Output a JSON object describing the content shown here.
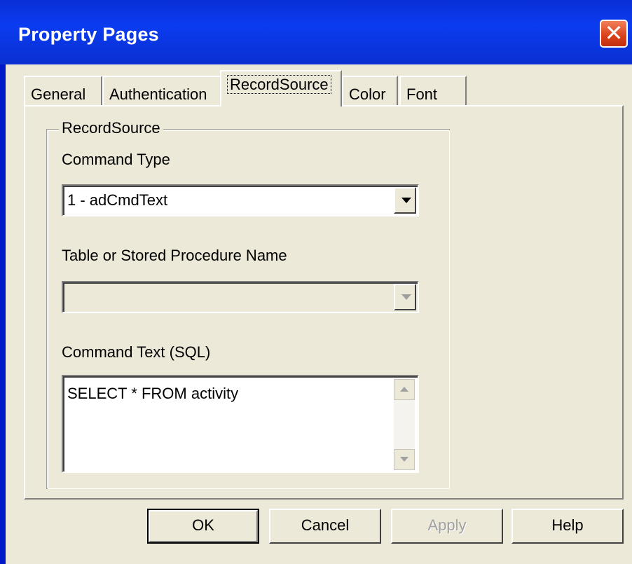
{
  "window": {
    "title": "Property Pages",
    "close_glyph": "✕"
  },
  "tabs": [
    {
      "label": "General"
    },
    {
      "label": "Authentication"
    },
    {
      "label": "RecordSource",
      "active": true
    },
    {
      "label": "Color"
    },
    {
      "label": "Font"
    }
  ],
  "recordsource": {
    "group_title": "RecordSource",
    "command_type_label": "Command Type",
    "command_type_value": "1 - adCmdText",
    "table_name_label": "Table or Stored Procedure Name",
    "table_name_value": "",
    "command_text_label": "Command Text (SQL)",
    "command_text_value": "SELECT * FROM activity"
  },
  "buttons": {
    "ok": "OK",
    "cancel": "Cancel",
    "apply": "Apply",
    "help": "Help"
  },
  "icons": {
    "close": "close-icon",
    "dropdown": "chevron-down-icon",
    "scroll_up": "scroll-up-icon",
    "scroll_down": "scroll-down-icon"
  }
}
